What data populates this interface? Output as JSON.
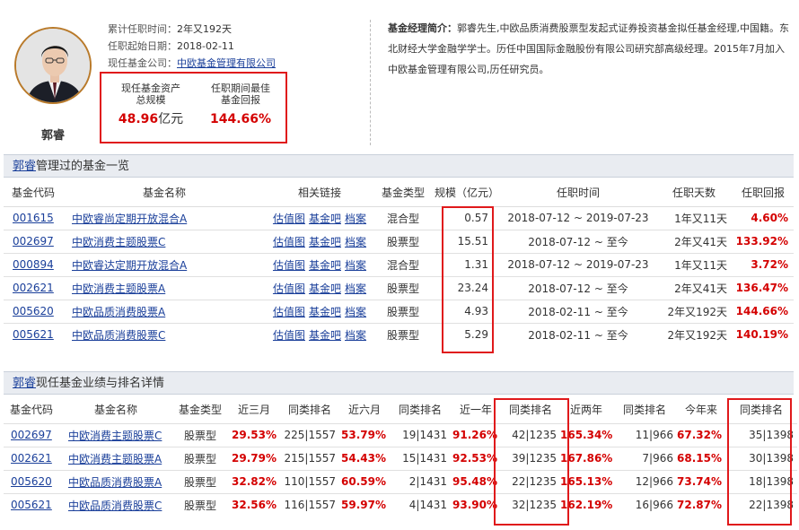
{
  "manager": {
    "name": "郭睿",
    "tenure_label": "累计任职时间：",
    "tenure_value": "2年又192天",
    "start_label": "任职起始日期：",
    "start_value": "2018-02-11",
    "company_label": "现任基金公司：",
    "company_value": "中欧基金管理有限公司",
    "asset_label_1": "现任基金资产",
    "asset_label_2": "总规模",
    "asset_value": "48.96",
    "asset_unit": "亿元",
    "best_label_1": "任职期间最佳",
    "best_label_2": "基金回报",
    "best_value": "144.66%",
    "intro_label": "基金经理简介：",
    "intro_text": "郭睿先生,中欧品质消费股票型发起式证券投资基金拟任基金经理,中国籍。东北财经大学金融学学士。历任中国国际金融股份有限公司研究部高级经理。2015年7月加入中欧基金管理有限公司,历任研究员。"
  },
  "section1": {
    "manager_link": "郭睿",
    "title_suffix": "管理过的基金一览",
    "headers": [
      "基金代码",
      "基金名称",
      "相关链接",
      "基金类型",
      "规模（亿元）",
      "任职时间",
      "任职天数",
      "任职回报"
    ],
    "link_labels": [
      "估值图",
      "基金吧",
      "档案"
    ],
    "rows": [
      {
        "code": "001615",
        "name": "中欧睿尚定期开放混合A",
        "type": "混合型",
        "scale": "0.57",
        "period": "2018-07-12 ~ 2019-07-23",
        "days": "1年又11天",
        "ret": "4.60%"
      },
      {
        "code": "002697",
        "name": "中欧消费主题股票C",
        "type": "股票型",
        "scale": "15.51",
        "period": "2018-07-12 ~ 至今",
        "days": "2年又41天",
        "ret": "133.92%"
      },
      {
        "code": "000894",
        "name": "中欧睿达定期开放混合A",
        "type": "混合型",
        "scale": "1.31",
        "period": "2018-07-12 ~ 2019-07-23",
        "days": "1年又11天",
        "ret": "3.72%"
      },
      {
        "code": "002621",
        "name": "中欧消费主题股票A",
        "type": "股票型",
        "scale": "23.24",
        "period": "2018-07-12 ~ 至今",
        "days": "2年又41天",
        "ret": "136.47%"
      },
      {
        "code": "005620",
        "name": "中欧品质消费股票A",
        "type": "股票型",
        "scale": "4.93",
        "period": "2018-02-11 ~ 至今",
        "days": "2年又192天",
        "ret": "144.66%"
      },
      {
        "code": "005621",
        "name": "中欧品质消费股票C",
        "type": "股票型",
        "scale": "5.29",
        "period": "2018-02-11 ~ 至今",
        "days": "2年又192天",
        "ret": "140.19%"
      }
    ]
  },
  "section2": {
    "manager_link": "郭睿",
    "title_suffix": "现任基金业绩与排名详情",
    "headers": [
      "基金代码",
      "基金名称",
      "基金类型",
      "近三月",
      "同类排名",
      "近六月",
      "同类排名",
      "近一年",
      "同类排名",
      "近两年",
      "同类排名",
      "今年来",
      "同类排名"
    ],
    "rows": [
      {
        "code": "002697",
        "name": "中欧消费主题股票C",
        "type": "股票型",
        "m3": "29.53%",
        "r3": "225|1557",
        "m6": "53.79%",
        "r6": "19|1431",
        "y1": "91.26%",
        "ry1": "42|1235",
        "y2": "165.34%",
        "ry2": "11|966",
        "ytd": "67.32%",
        "rytd": "35|1398"
      },
      {
        "code": "002621",
        "name": "中欧消费主题股票A",
        "type": "股票型",
        "m3": "29.79%",
        "r3": "215|1557",
        "m6": "54.43%",
        "r6": "15|1431",
        "y1": "92.53%",
        "ry1": "39|1235",
        "y2": "167.86%",
        "ry2": "7|966",
        "ytd": "68.15%",
        "rytd": "30|1398"
      },
      {
        "code": "005620",
        "name": "中欧品质消费股票A",
        "type": "股票型",
        "m3": "32.82%",
        "r3": "110|1557",
        "m6": "60.59%",
        "r6": "2|1431",
        "y1": "95.48%",
        "ry1": "22|1235",
        "y2": "165.13%",
        "ry2": "12|966",
        "ytd": "73.74%",
        "rytd": "18|1398"
      },
      {
        "code": "005621",
        "name": "中欧品质消费股票C",
        "type": "股票型",
        "m3": "32.56%",
        "r3": "116|1557",
        "m6": "59.97%",
        "r6": "4|1431",
        "y1": "93.90%",
        "ry1": "32|1235",
        "y2": "162.19%",
        "ry2": "16|966",
        "ytd": "72.87%",
        "rytd": "22|1398"
      }
    ]
  },
  "colors": {
    "accent_red": "#d40000",
    "link_blue": "#1a3f9a",
    "highlight_box": "#e0191b",
    "section_bg": "#e9ecf1"
  }
}
